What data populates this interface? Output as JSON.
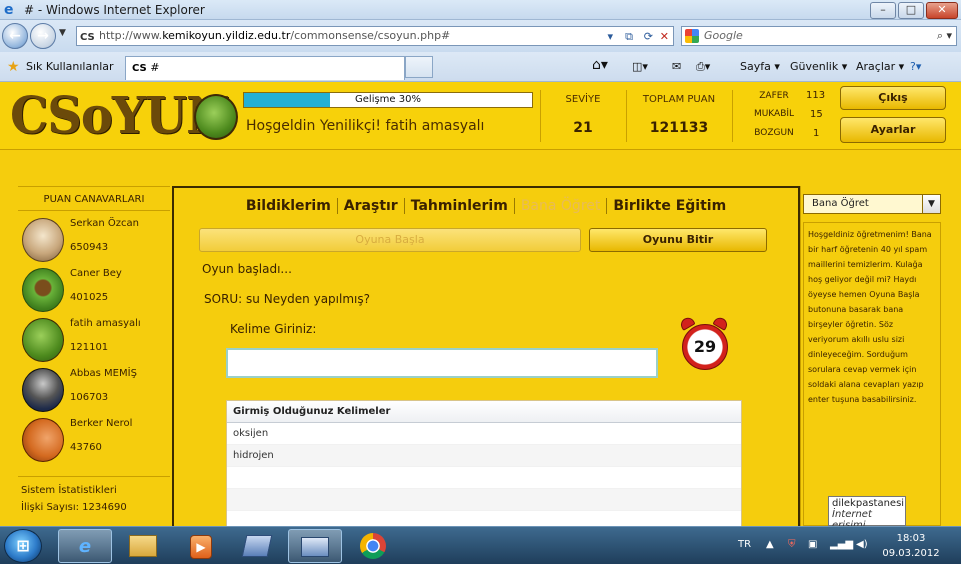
{
  "window": {
    "title": "# - Windows Internet Explorer",
    "minimize_symbol": "–",
    "maximize_symbol": "□",
    "close_symbol": "✕"
  },
  "address_bar": {
    "favicon_text": "CS",
    "url_prefix": "http://www.",
    "url_domain": "kemikoyun.yildiz.edu.tr",
    "url_suffix": "/commonsense/csoyun.php#",
    "search_placeholder": "Google"
  },
  "favorites_bar": {
    "favorites_label": "Sık Kullanılanlar",
    "tab_title": "#",
    "commands": [
      "Sayfa ▾",
      "Güvenlik ▾",
      "Araçlar ▾"
    ]
  },
  "header": {
    "logo": "CSoYUN",
    "progress_label": "Gelişme 30%",
    "progress_fraction": 0.3,
    "welcome": "Hoşgeldin Yenilikçi! fatih amasyalı",
    "level_label": "SEVİYE",
    "level_value": "21",
    "total_label": "TOPLAM PUAN",
    "total_value": "121133",
    "scores": [
      {
        "label": "ZAFER",
        "value": "113"
      },
      {
        "label": "MUKABİL",
        "value": "15"
      },
      {
        "label": "BOZGUN",
        "value": "1"
      }
    ],
    "logout_label": "Çıkış",
    "settings_label": "Ayarlar"
  },
  "left_panel": {
    "title": "PUAN CANAVARLARI",
    "users": [
      {
        "name": "Serkan Özcan",
        "points": "650943",
        "avatar": "elder-avatar-icon"
      },
      {
        "name": "Caner Bey",
        "points": "401025",
        "avatar": "green-monster-icon"
      },
      {
        "name": "fatih amasyalı",
        "points": "121101",
        "avatar": "zombie-monster-icon"
      },
      {
        "name": "Abbas MEMİŞ",
        "points": "106703",
        "avatar": "police-avatar-icon"
      },
      {
        "name": "Berker Nerol",
        "points": "43760",
        "avatar": "megaphone-avatar-icon"
      }
    ],
    "stats_title": "Sistem İstatistikleri",
    "stats_line": "İlişki Sayısı: 1234690"
  },
  "center": {
    "tabs": [
      "Bildiklerim",
      "Araştır",
      "Tahminlerim",
      "Bana Öğret",
      "Birlikte Eğitim"
    ],
    "start_button": "Oyuna Başla",
    "end_button": "Oyunu Bitir",
    "game_started": "Oyun başladı...",
    "question": "SORU: su Neyden yapılmış?",
    "word_prompt": "Kelime Giriniz:",
    "timer": "29",
    "table_header": "Girmiş Olduğunuz Kelimeler",
    "words": [
      "oksijen",
      "hidrojen",
      "",
      "",
      ""
    ]
  },
  "right_panel": {
    "select_value": "Bana Öğret",
    "select_arrow": "▼",
    "text": "Hoşgeldiniz öğretmenim! Bana bir harf öğretenin 40 yıl spam maillerini temizlerim. Kulağa hoş geliyor değil mi? Haydı öyeyse hemen Oyuna Başla butonuna basarak bana birşeyler öğretin. Söz veriyorum akıllı uslu sizi dinleyeceğim. Sorduğum sorulara cevap vermek için soldaki alana cevapları yazıp enter tuşuna basabilirsiniz."
  },
  "tooltip": {
    "line1": "dilekpastanesi",
    "line2": "İnternet erişimi"
  },
  "taskbar": {
    "language": "TR",
    "time": "18:03",
    "date": "09.03.2012"
  }
}
